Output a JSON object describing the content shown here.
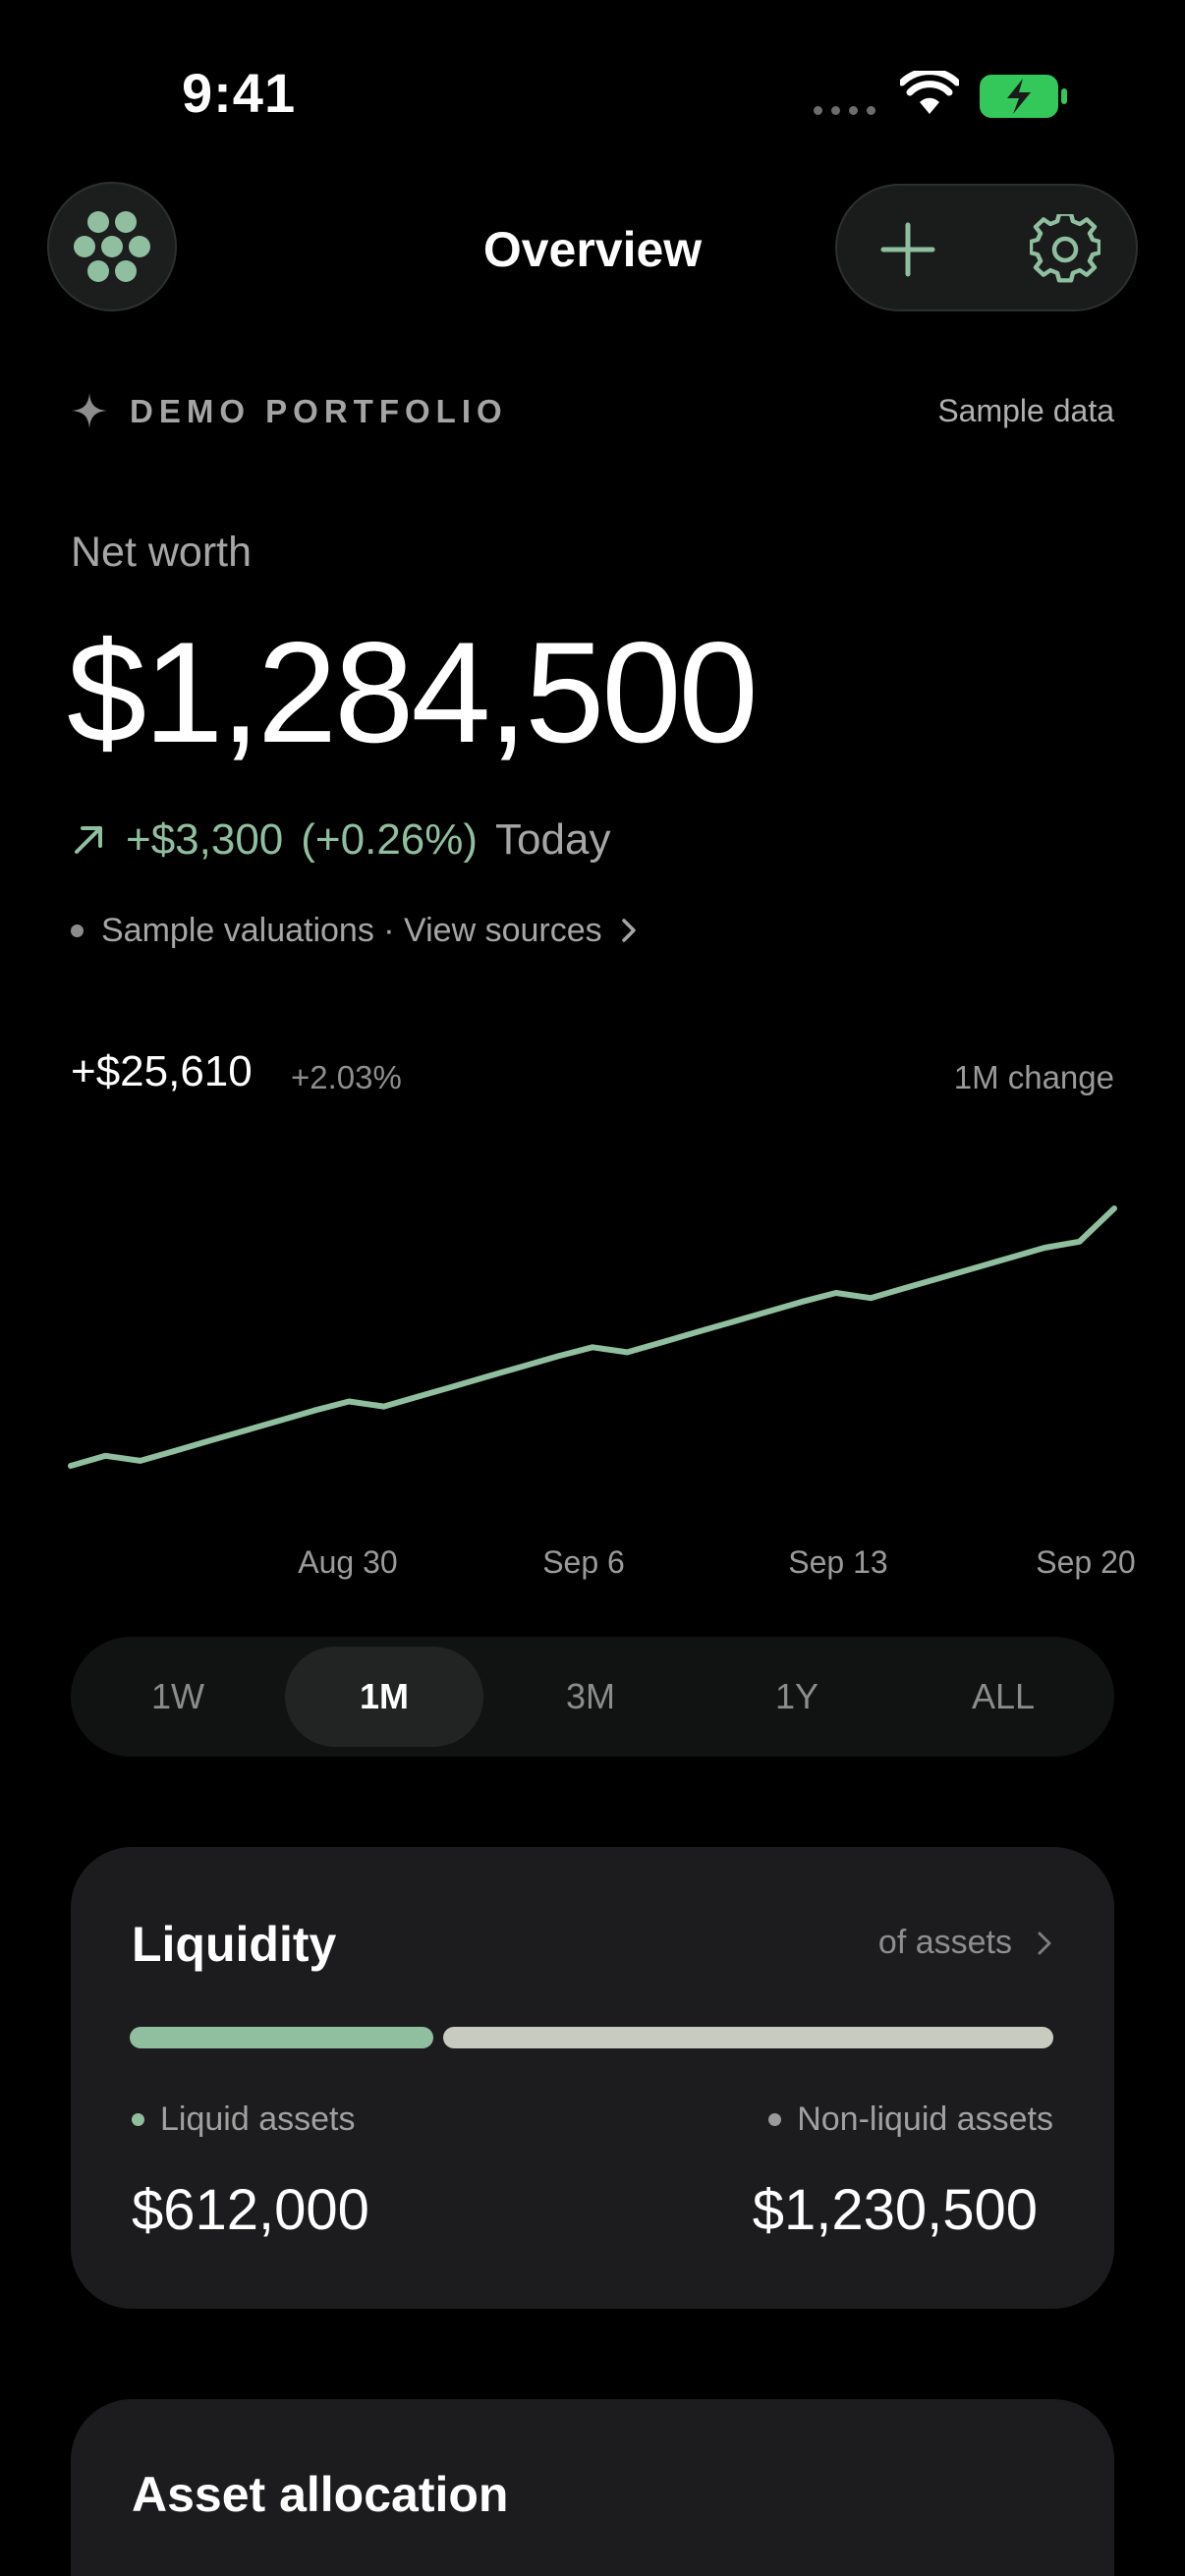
{
  "status_bar": {
    "time": "9:41"
  },
  "header": {
    "title": "Overview"
  },
  "demo": {
    "label": "DEMO PORTFOLIO",
    "sample_data": "Sample data"
  },
  "net_worth": {
    "label": "Net worth",
    "value": "$1,284,500",
    "change_amount": "+$3,300",
    "change_pct": "(+0.26%)",
    "change_period": "Today",
    "sources_text": "Sample valuations · View sources"
  },
  "chart_header": {
    "change": "+$25,610",
    "pct": "+2.03%",
    "period_label": "1M change"
  },
  "chart_data": {
    "type": "line",
    "x": [
      "Aug 23",
      "Aug 24",
      "Aug 25",
      "Aug 26",
      "Aug 27",
      "Aug 28",
      "Aug 29",
      "Aug 30",
      "Aug 31",
      "Sep 1",
      "Sep 2",
      "Sep 3",
      "Sep 4",
      "Sep 5",
      "Sep 6",
      "Sep 7",
      "Sep 8",
      "Sep 9",
      "Sep 10",
      "Sep 11",
      "Sep 12",
      "Sep 13",
      "Sep 14",
      "Sep 15",
      "Sep 16",
      "Sep 17",
      "Sep 18",
      "Sep 19",
      "Sep 20",
      "Sep 21"
    ],
    "series": [
      {
        "values": [
          1258890,
          1259890,
          1259390,
          1260390,
          1261390,
          1262390,
          1263390,
          1264390,
          1265290,
          1264790,
          1265790,
          1266790,
          1267790,
          1268790,
          1269790,
          1270690,
          1270190,
          1271190,
          1272190,
          1273190,
          1274190,
          1275190,
          1276090,
          1275590,
          1276590,
          1277590,
          1278590,
          1279590,
          1280590,
          1281200,
          1284500
        ]
      }
    ],
    "x_tick_labels": [
      "Aug 30",
      "Sep 6",
      "Sep 13",
      "Sep 20"
    ],
    "line_color": "#8fbf9f",
    "grid": false
  },
  "range_selector": {
    "options": [
      "1W",
      "1M",
      "3M",
      "1Y",
      "ALL"
    ],
    "selected": "1M"
  },
  "liquidity": {
    "title": "Liquidity",
    "link": "of assets",
    "liquid_label": "Liquid assets",
    "liquid_value": "$612,000",
    "liquid_amount": 612000,
    "nonliquid_label": "Non-liquid assets",
    "nonliquid_value": "$1,230,500",
    "nonliquid_amount": 1230500,
    "liquid_color": "#8fbf9f",
    "nonliquid_color": "#c8cbc0"
  },
  "allocation": {
    "title": "Asset allocation"
  },
  "colors": {
    "accent": "#8fbf9f",
    "background": "#000000",
    "card": "#1c1c1e"
  }
}
